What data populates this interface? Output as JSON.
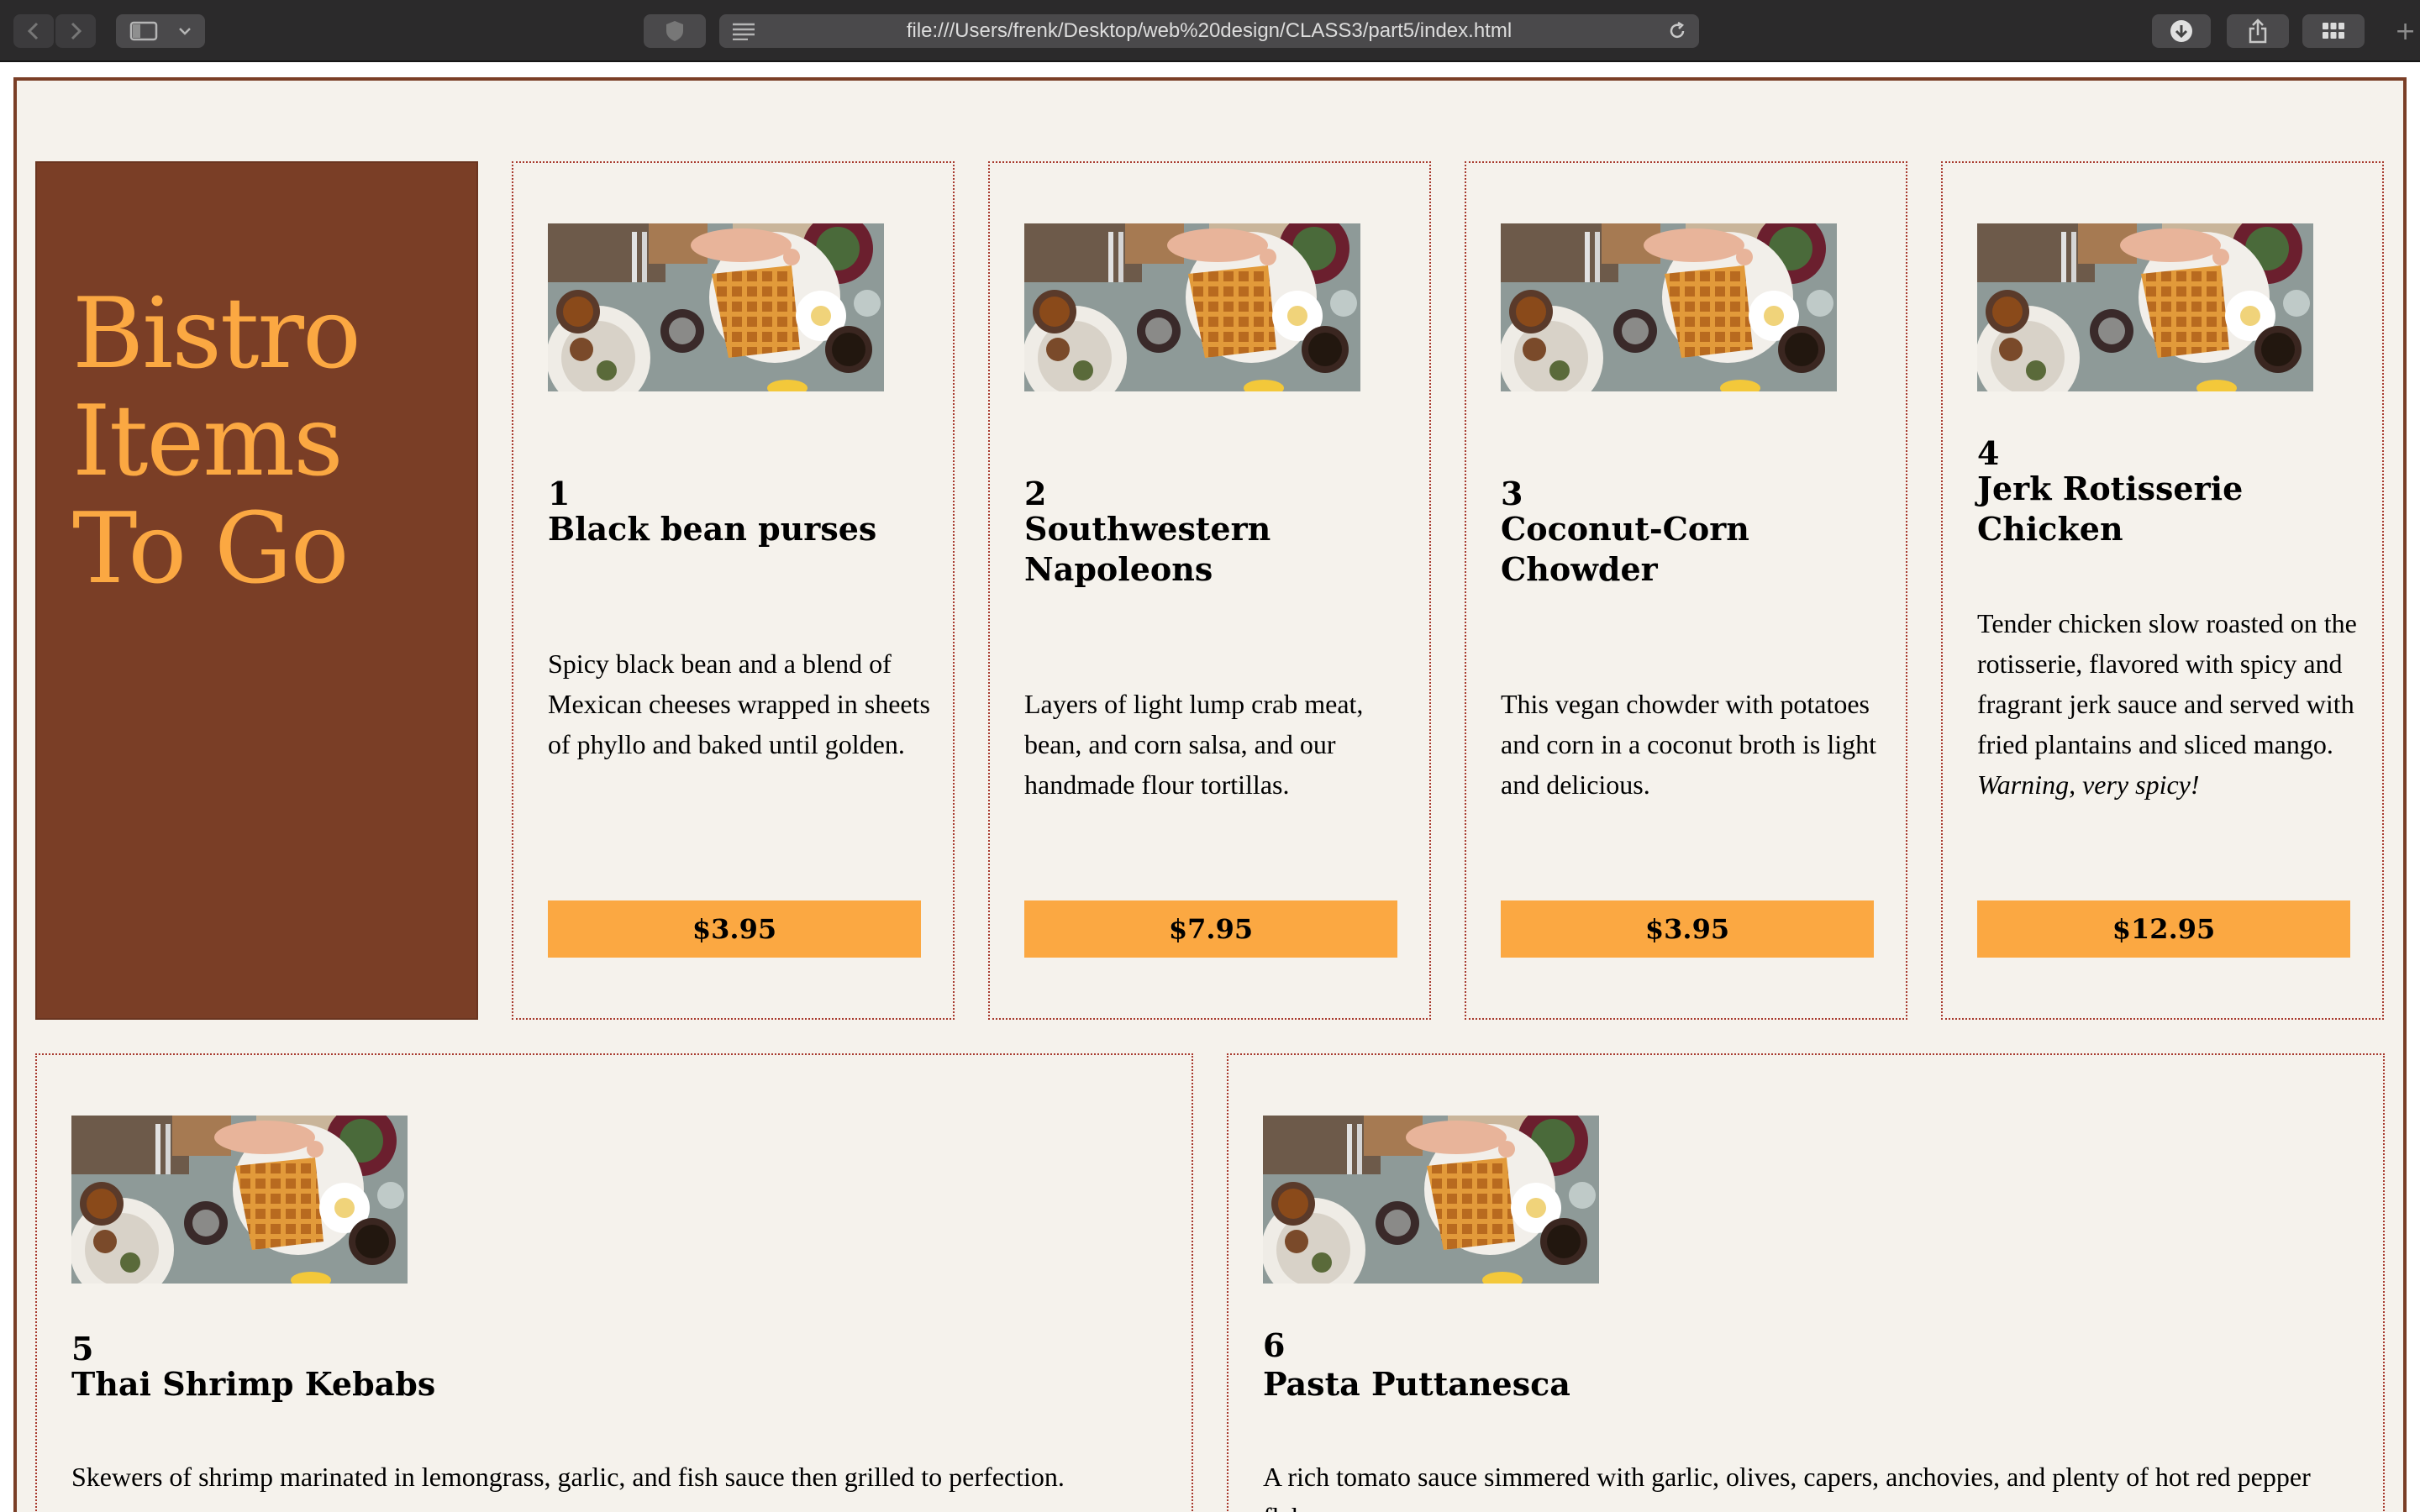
{
  "browser": {
    "url": "file:///Users/frenk/Desktop/web%20design/CLASS3/part5/index.html",
    "new_tab_label": "+"
  },
  "hero": {
    "title_line1": "Bistro",
    "title_line2": "Items",
    "title_line3": "To Go"
  },
  "items": [
    {
      "number": "1",
      "name_line1": "Black bean purses",
      "name_line2": "",
      "description": "Spicy black bean and a blend of Mexican cheeses wrapped in sheets of phyllo and baked until golden.",
      "price": "$3.95",
      "image": "food-photo"
    },
    {
      "number": "2",
      "name_line1": "Southwestern",
      "name_line2": "Napoleons",
      "description": "Layers of light lump crab meat, bean, and corn salsa, and our handmade flour tortillas.",
      "price": "$7.95",
      "image": "food-photo"
    },
    {
      "number": "3",
      "name_line1": "Coconut-Corn",
      "name_line2": "Chowder",
      "description": "This vegan chowder with potatoes and corn in a coconut broth is light and delicious.",
      "price": "$3.95",
      "image": "food-photo"
    },
    {
      "number": "4",
      "name_line1": "Jerk Rotisserie",
      "name_line2": "Chicken",
      "description": "Tender chicken slow roasted on the rotisserie, flavored with spicy and fragrant jerk sauce and served with fried plantains and sliced mango.",
      "warning": "Warning, very spicy!",
      "price": "$12.95",
      "image": "food-photo"
    },
    {
      "number": "5",
      "name_line1": "Thai Shrimp Kebabs",
      "name_line2": "",
      "description": "Skewers of shrimp marinated in lemongrass, garlic, and fish sauce then grilled to perfection.",
      "image": "food-photo"
    },
    {
      "number": "6",
      "name_line1": "Pasta Puttanesca",
      "name_line2": "",
      "description": "A rich tomato sauce simmered with garlic, olives, capers, anchovies, and plenty of hot red pepper flakes.",
      "image": "food-photo"
    }
  ],
  "colors": {
    "brand_brown": "#7a3e26",
    "accent_orange": "#fba842",
    "page_background": "#f5f2ec",
    "card_border": "#a83a2e"
  }
}
